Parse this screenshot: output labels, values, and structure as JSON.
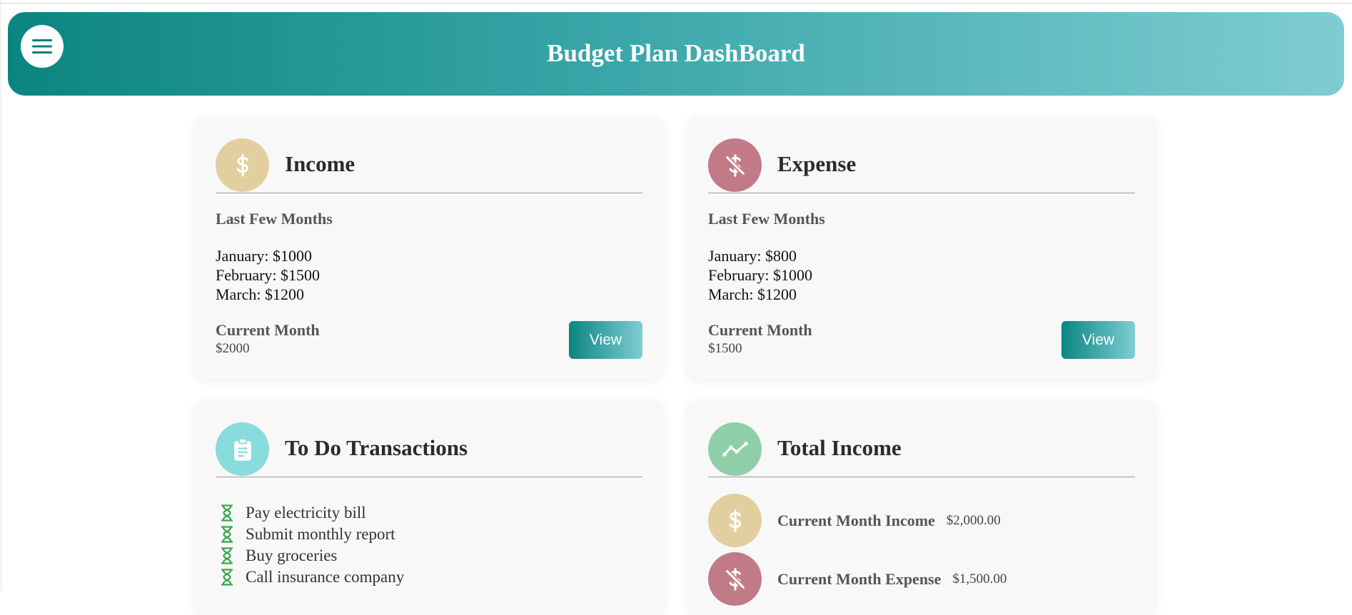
{
  "header": {
    "title": "Budget Plan DashBoard",
    "menu_icon": "hamburger-menu-icon"
  },
  "colors": {
    "header_start": "#0b8581",
    "header_end": "#7fcdd3",
    "income_icon": "#e2cf9f",
    "expense_icon": "#c27a86",
    "todo_icon": "#88dcdb",
    "total_income_icon": "#8fcfa8",
    "todo_hourglass": "#3aa64a"
  },
  "income": {
    "title": "Income",
    "icon": "dollar-icon",
    "last_months_label": "Last Few Months",
    "months": [
      "January: $1000",
      "February: $1500",
      "March: $1200"
    ],
    "current_label": "Current Month",
    "current_value": "$2000",
    "view_label": "View"
  },
  "expense": {
    "title": "Expense",
    "icon": "dollar-off-icon",
    "last_months_label": "Last Few Months",
    "months": [
      "January: $800",
      "February: $1000",
      "March: $1200"
    ],
    "current_label": "Current Month",
    "current_value": "$1500",
    "view_label": "View"
  },
  "todo": {
    "title": "To Do Transactions",
    "icon": "clipboard-icon",
    "items": [
      "Pay electricity bill",
      "Submit monthly report",
      "Buy groceries",
      "Call insurance company"
    ]
  },
  "total_income": {
    "title": "Total Income",
    "icon": "trend-line-icon",
    "rows": [
      {
        "label": "Current Month Income",
        "value": "$2,000.00",
        "icon": "dollar-icon"
      },
      {
        "label": "Current Month Expense",
        "value": "$1,500.00",
        "icon": "dollar-off-icon"
      }
    ]
  }
}
